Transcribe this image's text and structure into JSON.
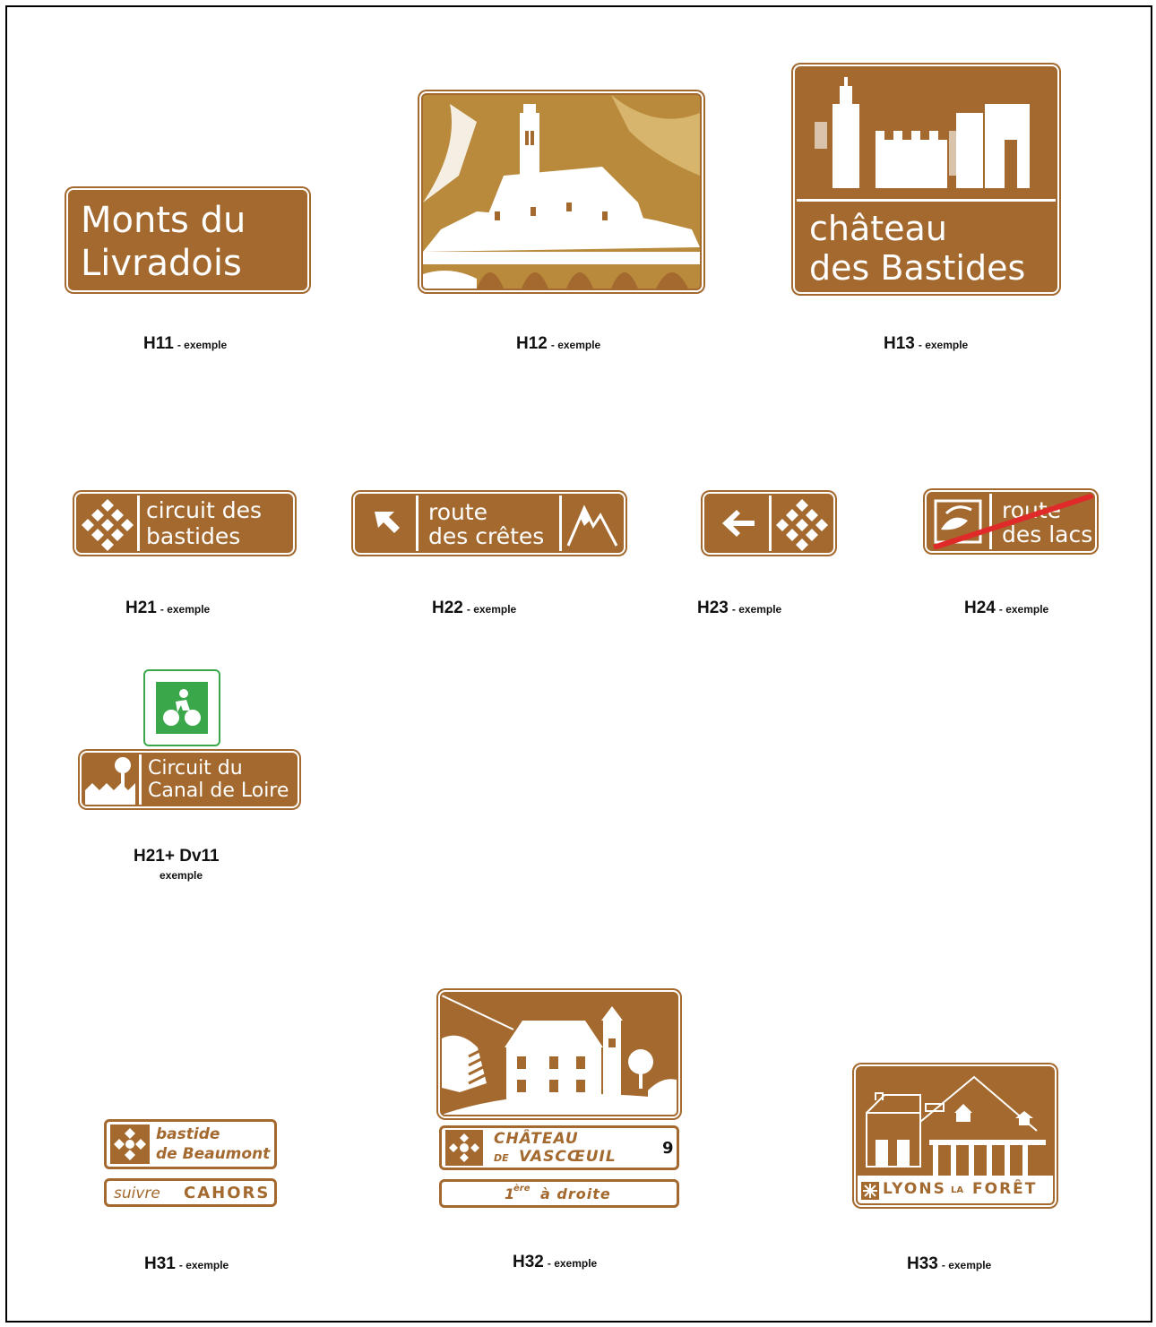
{
  "colors": {
    "brown": "#a3692e",
    "green": "#3aa84a",
    "red": "#e02a2a",
    "white": "#ffffff",
    "ink": "#111111"
  },
  "signs": {
    "h11": {
      "line1": "Monts  du",
      "line2": "Livradois",
      "code": "H11",
      "sub": "- exemple"
    },
    "h12": {
      "code": "H12",
      "sub": "- exemple",
      "picture": "town-cathedral-bridge-pictogram"
    },
    "h13": {
      "line1": "château",
      "line2": "des  Bastides",
      "code": "H13",
      "sub": "- exemple",
      "picture": "castle-ruins-pictogram"
    },
    "h21": {
      "line1": "circuit  des",
      "line2": "bastides",
      "code": "H21",
      "sub": "- exemple",
      "icon": "bastide-diamond-icon"
    },
    "h22": {
      "line1": "route",
      "line2": "des crêtes",
      "code": "H22",
      "sub": "- exemple",
      "icon_left": "arrow-up-left-icon",
      "icon_right": "mountain-icon"
    },
    "h23": {
      "code": "H23",
      "sub": "- exemple",
      "icon_left": "arrow-left-icon",
      "icon_right": "bastide-diamond-icon"
    },
    "h24": {
      "line1": "route",
      "line2": "des lacs",
      "code": "H24",
      "sub": "- exemple",
      "icon": "lake-icon"
    },
    "h21dv11": {
      "line1": "Circuit du",
      "line2": "Canal de Loire",
      "code": "H21+ Dv11",
      "sub": "exemple",
      "icon_top": "cyclist-icon",
      "icon": "canal-tree-icon"
    },
    "h31": {
      "line1": "bastide",
      "line2": "de Beaumont",
      "follow_prefix": "suivre",
      "follow_city": "CAHORS",
      "code": "H31",
      "sub": "- exemple"
    },
    "h32": {
      "line1": "CHÂTEAU",
      "line2_small": "DE",
      "line2": "VASCŒUIL",
      "distance": "9",
      "dir_sup": "ère",
      "dir_num": "1",
      "dir_text": "à  droite",
      "code": "H32",
      "sub": "- exemple",
      "picture": "manor-pictogram"
    },
    "h33": {
      "name_a": "LYONS",
      "name_b": "LA",
      "name_c": "FORÊT",
      "code": "H33",
      "sub": "- exemple",
      "picture": "market-hall-pictogram"
    }
  }
}
